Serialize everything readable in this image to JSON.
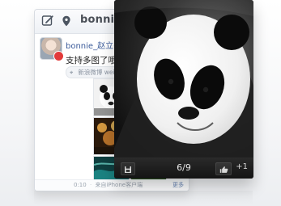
{
  "feed": {
    "title": "bonnie_",
    "post": {
      "username": "bonnie_赵立冬",
      "text": "支持多图了哦！",
      "source": "新浪微博 weib…",
      "time": "0:10",
      "client": "来自iPhone客户端",
      "more": "更多"
    },
    "thumbnails": [
      {
        "name": "panda-thumb"
      },
      {
        "name": "green-leaves-thumb"
      },
      {
        "name": "orange-lights-thumb"
      },
      {
        "name": "sculpture-thumb"
      },
      {
        "name": "teal-water-thumb"
      },
      {
        "name": "green-field-thumb"
      }
    ]
  },
  "viewer": {
    "counter": "6/9",
    "like_count": "+1"
  },
  "icons": {
    "compose": "compose-icon",
    "location": "location-pin-icon",
    "save": "save-icon",
    "like": "thumbs-up-icon"
  },
  "colors": {
    "link": "#3b5b9a",
    "badge_red": "#e23a3a",
    "viewer_bg": "#111111"
  }
}
